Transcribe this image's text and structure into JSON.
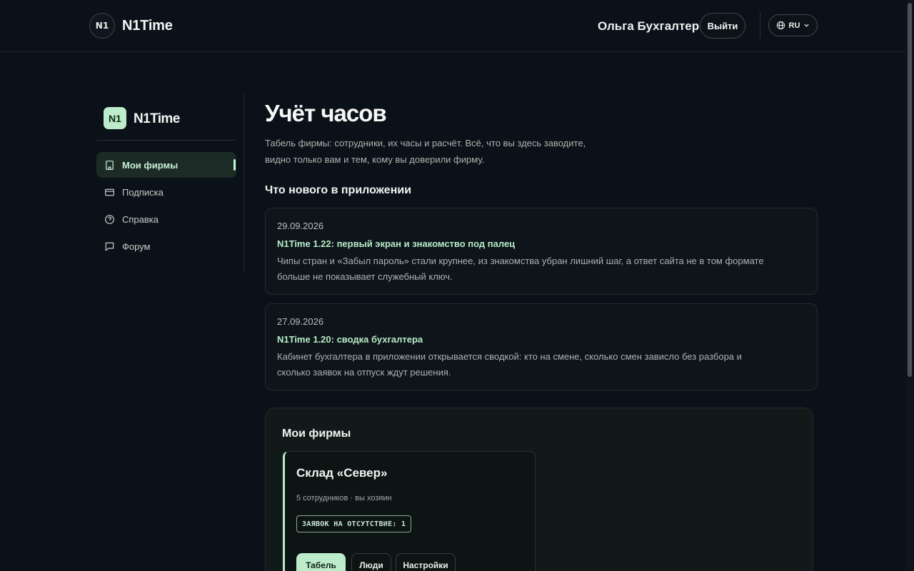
{
  "header": {
    "brand_badge": "N1",
    "brand_name": "N1Time",
    "user_name": "Ольга Бухгалтер",
    "logout_label": "Выйти",
    "language": "RU"
  },
  "sidebar": {
    "logo_badge": "N1",
    "brand_name": "N1Time",
    "items": [
      {
        "label": "Мои фирмы",
        "icon": "building-icon",
        "active": true
      },
      {
        "label": "Подписка",
        "icon": "card-icon",
        "active": false
      },
      {
        "label": "Справка",
        "icon": "help-icon",
        "active": false
      },
      {
        "label": "Форум",
        "icon": "chat-icon",
        "active": false
      }
    ]
  },
  "main": {
    "title": "Учёт часов",
    "description_line1": "Табель фирмы: сотрудники, их часы и расчёт. Всё, что вы здесь заводите,",
    "description_line2": "видно только вам и тем, кому вы доверили фирму.",
    "news_heading": "Что нового в приложении",
    "news": [
      {
        "date": "29.09.2026",
        "title": "N1Time 1.22: первый экран и знакомство под палец",
        "body": "Чипы стран и «Забыл пароль» стали крупнее, из знакомства убран лишний шаг, а ответ сайта не в том формате больше не показывает служебный ключ."
      },
      {
        "date": "27.09.2026",
        "title": "N1Time 1.20: сводка бухгалтера",
        "body": "Кабинет бухгалтера в приложении открывается сводкой: кто на смене, сколько смен зависло без разбора и сколько заявок на отпуск ждут решения."
      }
    ],
    "firms": {
      "title": "Мои фирмы",
      "items": [
        {
          "name": "Склад «Север»",
          "meta": "5 сотрудников · вы хозяин",
          "badge": "ЗАЯВОК НА ОТСУТСТВИЕ: 1",
          "buttons": [
            "Табель",
            "Люди",
            "Настройки"
          ]
        }
      ]
    }
  },
  "colors": {
    "background": "#0b1118",
    "accent": "#bdeccb",
    "accent_text": "#b9ecc8"
  }
}
